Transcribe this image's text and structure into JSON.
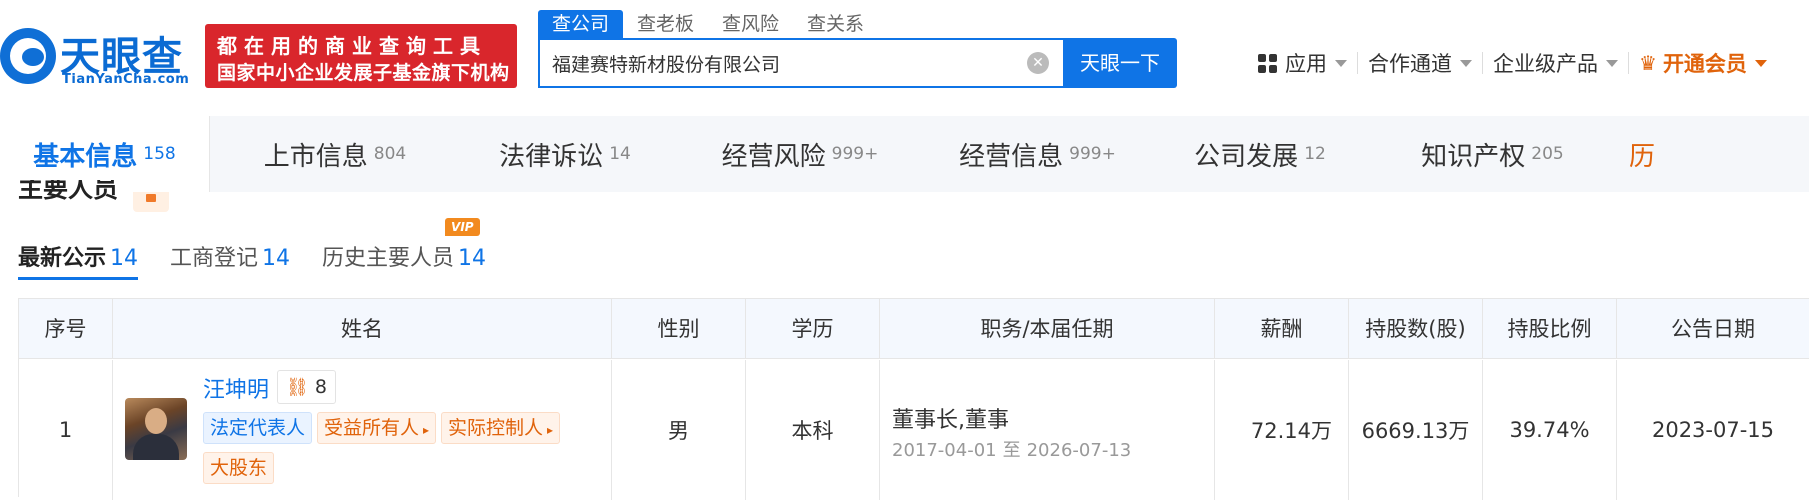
{
  "header": {
    "logo_name": "天眼查",
    "logo_domain": "TianYanCha.com",
    "slogan_line1": "都在用的商业查询工具",
    "slogan_line2": "国家中小企业发展子基金旗下机构"
  },
  "search": {
    "tabs": [
      {
        "label": "查公司",
        "active": true
      },
      {
        "label": "查老板",
        "active": false
      },
      {
        "label": "查风险",
        "active": false
      },
      {
        "label": "查关系",
        "active": false
      }
    ],
    "value": "福建赛特新材股份有限公司",
    "button_label": "天眼一下"
  },
  "topnav": {
    "apps": "应用",
    "channel": "合作通道",
    "enterprise": "企业级产品",
    "vip": "开通会员"
  },
  "main_tabs": [
    {
      "label": "基本信息",
      "count": "158"
    },
    {
      "label": "上市信息",
      "count": "804"
    },
    {
      "label": "法律诉讼",
      "count": "14"
    },
    {
      "label": "经营风险",
      "count": "999+"
    },
    {
      "label": "经营信息",
      "count": "999+"
    },
    {
      "label": "公司发展",
      "count": "12"
    },
    {
      "label": "知识产权",
      "count": "205"
    },
    {
      "label": "历",
      "count": ""
    }
  ],
  "section": {
    "title": "主要人员"
  },
  "sub_tabs": [
    {
      "label": "最新公示",
      "count": "14"
    },
    {
      "label": "工商登记",
      "count": "14"
    },
    {
      "label": "历史主要人员",
      "count": "14",
      "badge": "VIP"
    }
  ],
  "table": {
    "headers": [
      "序号",
      "姓名",
      "性别",
      "学历",
      "职务/本届任期",
      "薪酬",
      "持股数(股)",
      "持股比例",
      "公告日期"
    ],
    "row": {
      "index": "1",
      "name": "汪坤明",
      "relation_count": "8",
      "tags": {
        "legal": "法定代表人",
        "beneficiary": "受益所有人",
        "controller": "实际控制人",
        "major": "大股东"
      },
      "gender": "男",
      "education": "本科",
      "role": "董事长,董事",
      "term_start": "2017-04-01",
      "term_sep": "至",
      "term_end": "2026-07-13",
      "salary": "72.14万",
      "shares": "6669.13万",
      "ratio": "39.74%",
      "date": "2023-07-15"
    }
  },
  "colors": {
    "brand_blue": "#0f74e6",
    "slogan_red": "#d9262c",
    "vip_orange": "#e0630b"
  }
}
